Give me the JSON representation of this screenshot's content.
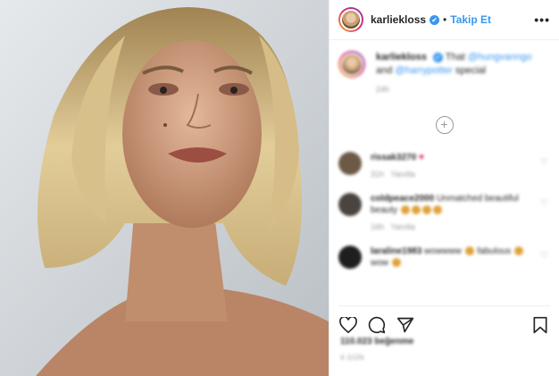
{
  "post": {
    "username": "karliekloss",
    "verified_mark": "✔",
    "separator": "•",
    "follow_label": "Takip Et",
    "more_label": "•••"
  },
  "caption": {
    "username": "karliekloss",
    "text_prefix": "That",
    "mention1": "@hungvanngo",
    "text_mid": "and",
    "mention2": "@harrypotter",
    "text_suffix": "special",
    "time": "24h"
  },
  "comments": [
    {
      "user": "rissak3270",
      "text": "♥",
      "time": "31h",
      "reply": "Yanıtla",
      "avatar_color": "#6c5a47"
    },
    {
      "user": "coldpeace2000",
      "text": "Unmatched beautiful beauty",
      "time": "16h",
      "reply": "Yanıtla",
      "avatar_color": "#4a4440"
    },
    {
      "user": "laraline1983",
      "text": "wowwww",
      "text2": "fabulous",
      "text3": "wow",
      "time": "",
      "reply": "",
      "avatar_color": "#1e1e1e"
    }
  ],
  "actions": {
    "like_icon": "heart-icon",
    "comment_icon": "comment-icon",
    "share_icon": "share-icon",
    "save_icon": "bookmark-icon"
  },
  "likes_text": "110.023 beğenme",
  "date_text": "4 GÜN"
}
